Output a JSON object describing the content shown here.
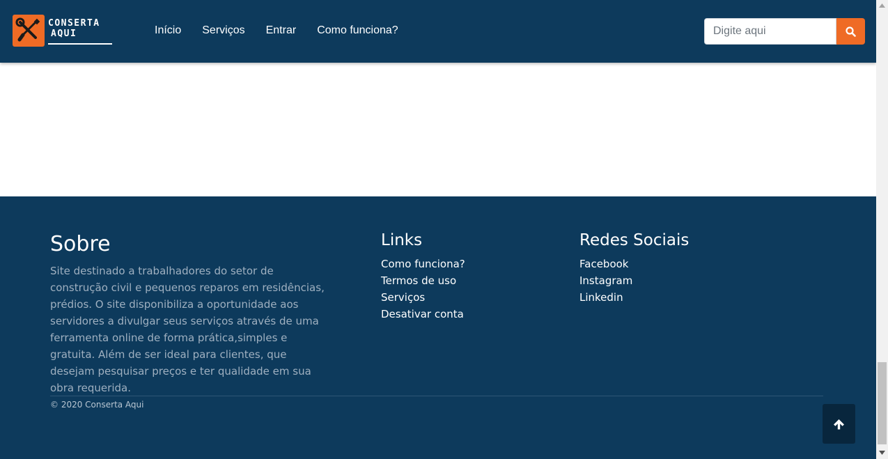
{
  "brand": {
    "line1": "CONSERTA",
    "line2": "AQUI",
    "logo_icon": "tools-icon",
    "logo_color": "#ef6b25"
  },
  "nav": {
    "items": [
      {
        "label": "Início"
      },
      {
        "label": "Serviços"
      },
      {
        "label": "Entrar"
      },
      {
        "label": "Como funciona?"
      }
    ]
  },
  "search": {
    "placeholder": "Digite aqui",
    "value": "",
    "button_icon": "search-icon"
  },
  "footer": {
    "sobre": {
      "title": "Sobre",
      "text": "Site destinado a trabalhadores do setor de construção civil e pequenos reparos em residências, prédios. O site disponibiliza a oportunidade aos servidores a divulgar seus serviços através de uma ferramenta online de forma prática,simples e gratuita. Além de ser ideal para clientes, que desejam pesquisar preços e ter qualidade em sua obra requerida."
    },
    "links": {
      "title": "Links",
      "items": [
        {
          "label": "Como funciona?"
        },
        {
          "label": "Termos de uso"
        },
        {
          "label": "Serviços"
        },
        {
          "label": "Desativar conta"
        }
      ]
    },
    "redes": {
      "title": "Redes Sociais",
      "items": [
        {
          "label": "Facebook"
        },
        {
          "label": "Instagram"
        },
        {
          "label": "Linkedin"
        }
      ]
    },
    "copyright": "© 2020 Conserta Aqui",
    "back_to_top_icon": "arrow-up-icon"
  },
  "colors": {
    "navy": "#0d3a5c",
    "accent": "#ef6b25"
  }
}
